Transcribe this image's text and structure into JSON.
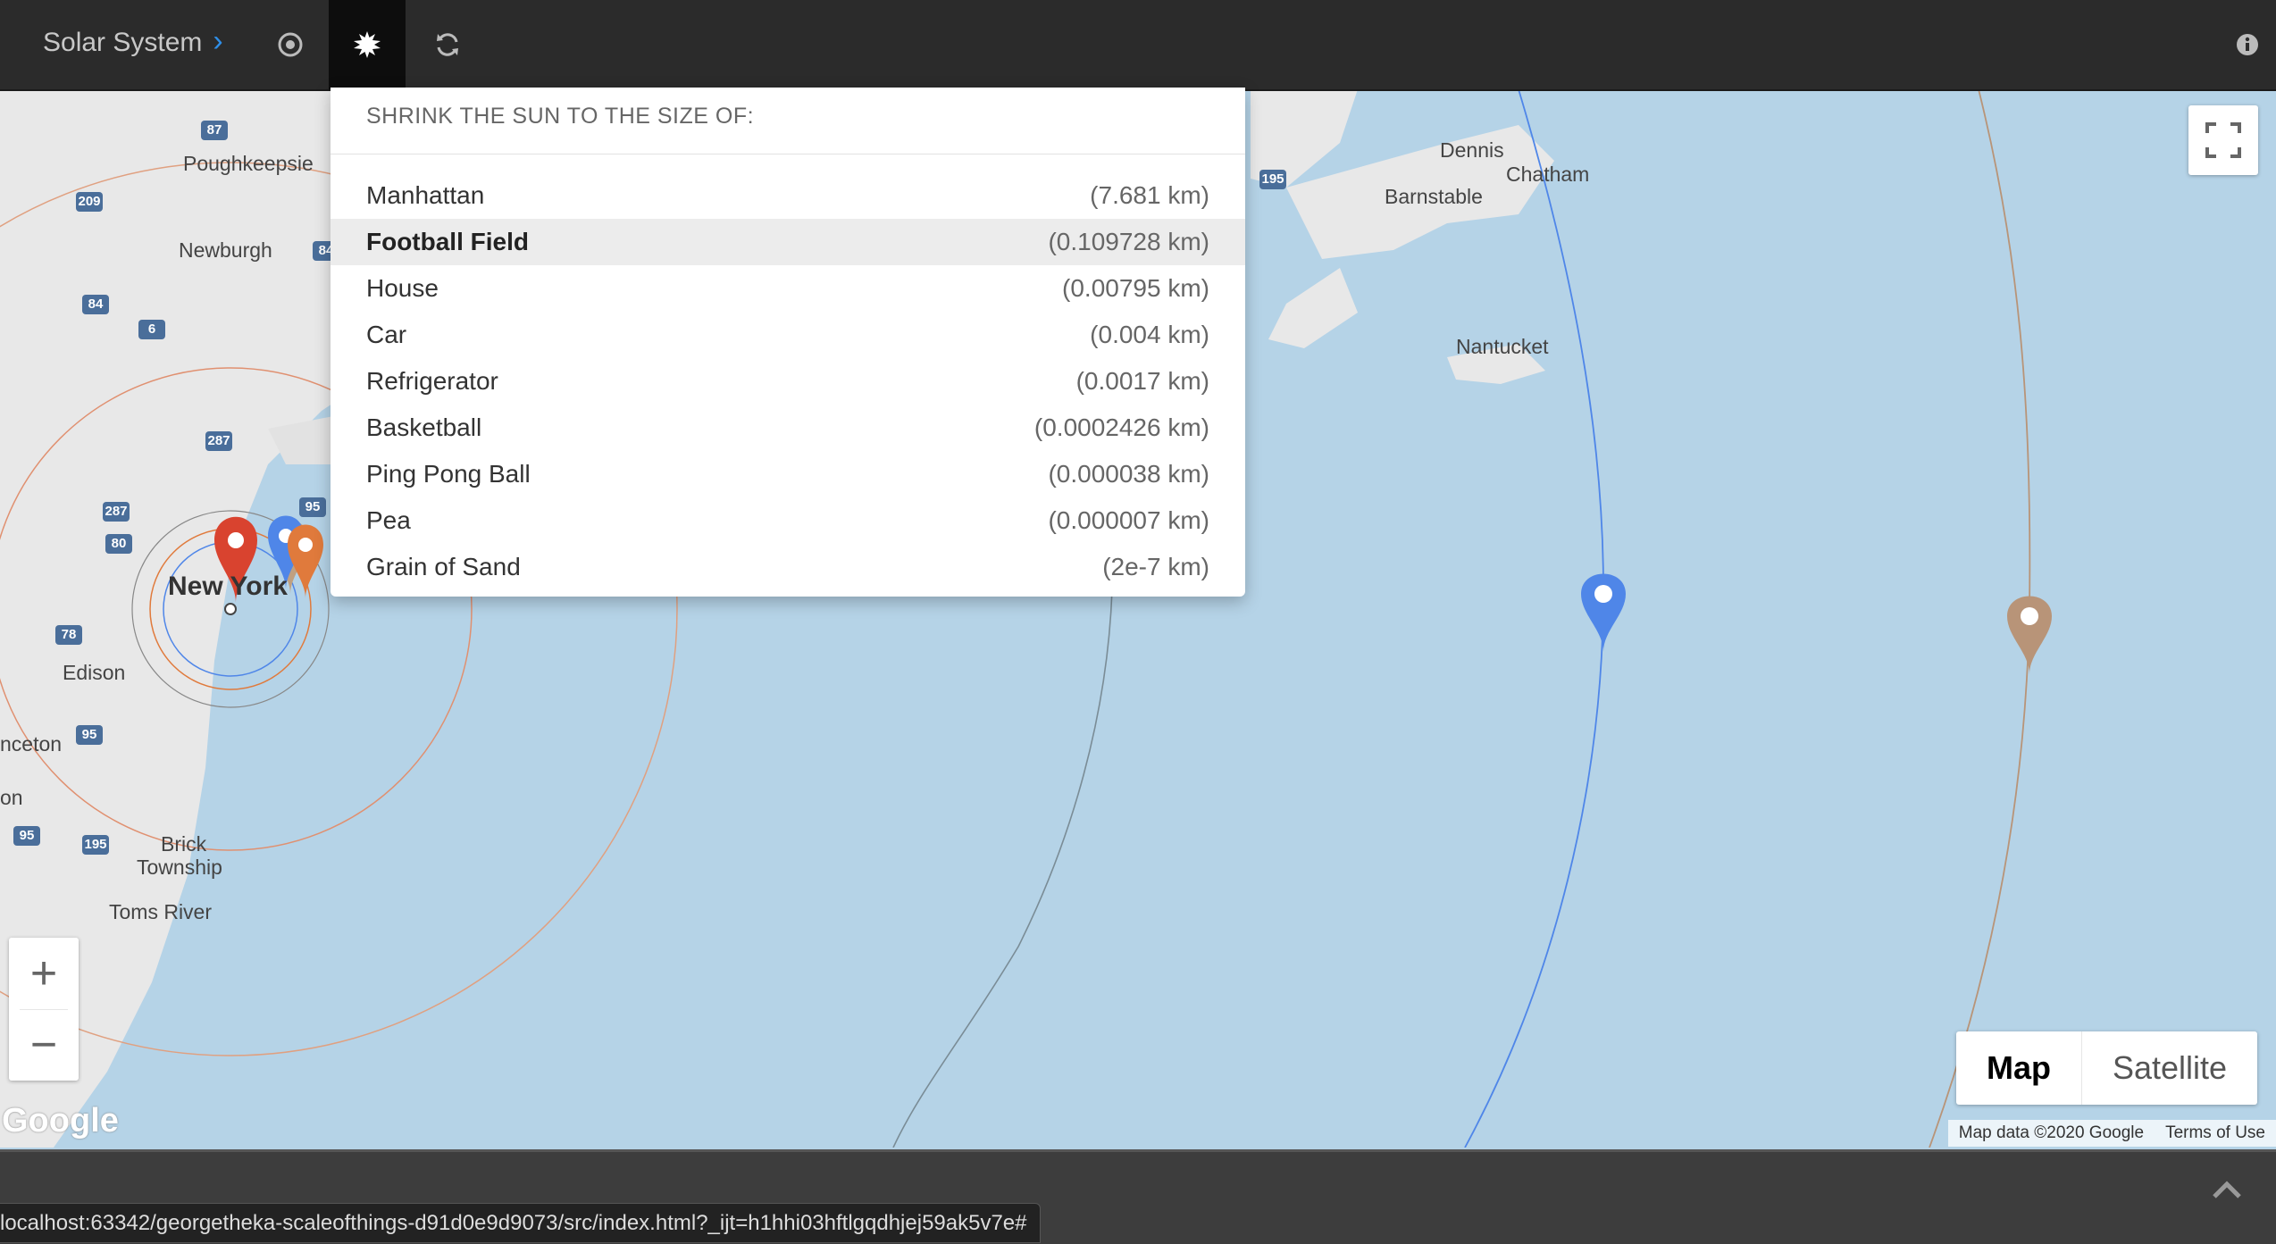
{
  "topbar": {
    "title": "Solar System",
    "buttons": [
      {
        "name": "planets",
        "icon": "target-icon"
      },
      {
        "name": "sun-size",
        "icon": "sun-icon",
        "active": true
      },
      {
        "name": "refresh",
        "icon": "refresh-icon"
      }
    ],
    "info_icon": "info-icon"
  },
  "dropdown": {
    "header": "SHRINK THE SUN TO THE SIZE OF:",
    "items": [
      {
        "label": "Manhattan",
        "size": "(7.681 km)"
      },
      {
        "label": "Football Field",
        "size": "(0.109728 km)",
        "selected": true
      },
      {
        "label": "House",
        "size": "(0.00795 km)"
      },
      {
        "label": "Car",
        "size": "(0.004 km)"
      },
      {
        "label": "Refrigerator",
        "size": "(0.0017 km)"
      },
      {
        "label": "Basketball",
        "size": "(0.0002426 km)"
      },
      {
        "label": "Ping Pong Ball",
        "size": "(0.000038 km)"
      },
      {
        "label": "Pea",
        "size": "(0.000007 km)"
      },
      {
        "label": "Grain of Sand",
        "size": "(2e-7 km)"
      }
    ]
  },
  "map": {
    "labels": {
      "poughkeepsie": "Poughkeepsie",
      "newburgh": "Newburgh",
      "new_york": "New York",
      "edison": "Edison",
      "princeton": "nceton",
      "trenton": "on",
      "brick": "Brick",
      "township": "Township",
      "toms_river": "Toms River",
      "dennis": "Dennis",
      "chatham": "Chatham",
      "barnstable": "Barnstable",
      "nantucket": "Nantucket"
    },
    "shields": [
      "87",
      "209",
      "84",
      "6",
      "287",
      "287",
      "80",
      "95",
      "78",
      "95",
      "95",
      "195",
      "195",
      "84"
    ],
    "controls": {
      "zoom_in": "+",
      "zoom_out": "−",
      "map_type": [
        "Map",
        "Satellite"
      ],
      "selected_type": "Map"
    },
    "logo": "Google",
    "attribution": [
      "Map data ©2020 Google",
      "Terms of Use"
    ],
    "colors": {
      "water": "#b5d3e7",
      "land": "#e8e8e8",
      "mercury_pin": "#9e9e9e",
      "venus_pin": "#c0a080",
      "earth_pin": "#4f86e8",
      "mars_pin": "#e07a3c",
      "sun_pin": "#d9432f",
      "jupiter_pin": "#b89478"
    }
  },
  "statusbar": {
    "url": "localhost:63342/georgetheka-scaleofthings-d91d0e9d9073/src/index.html?_ijt=h1hhi03hftlgqdhjej59ak5v7e#"
  }
}
